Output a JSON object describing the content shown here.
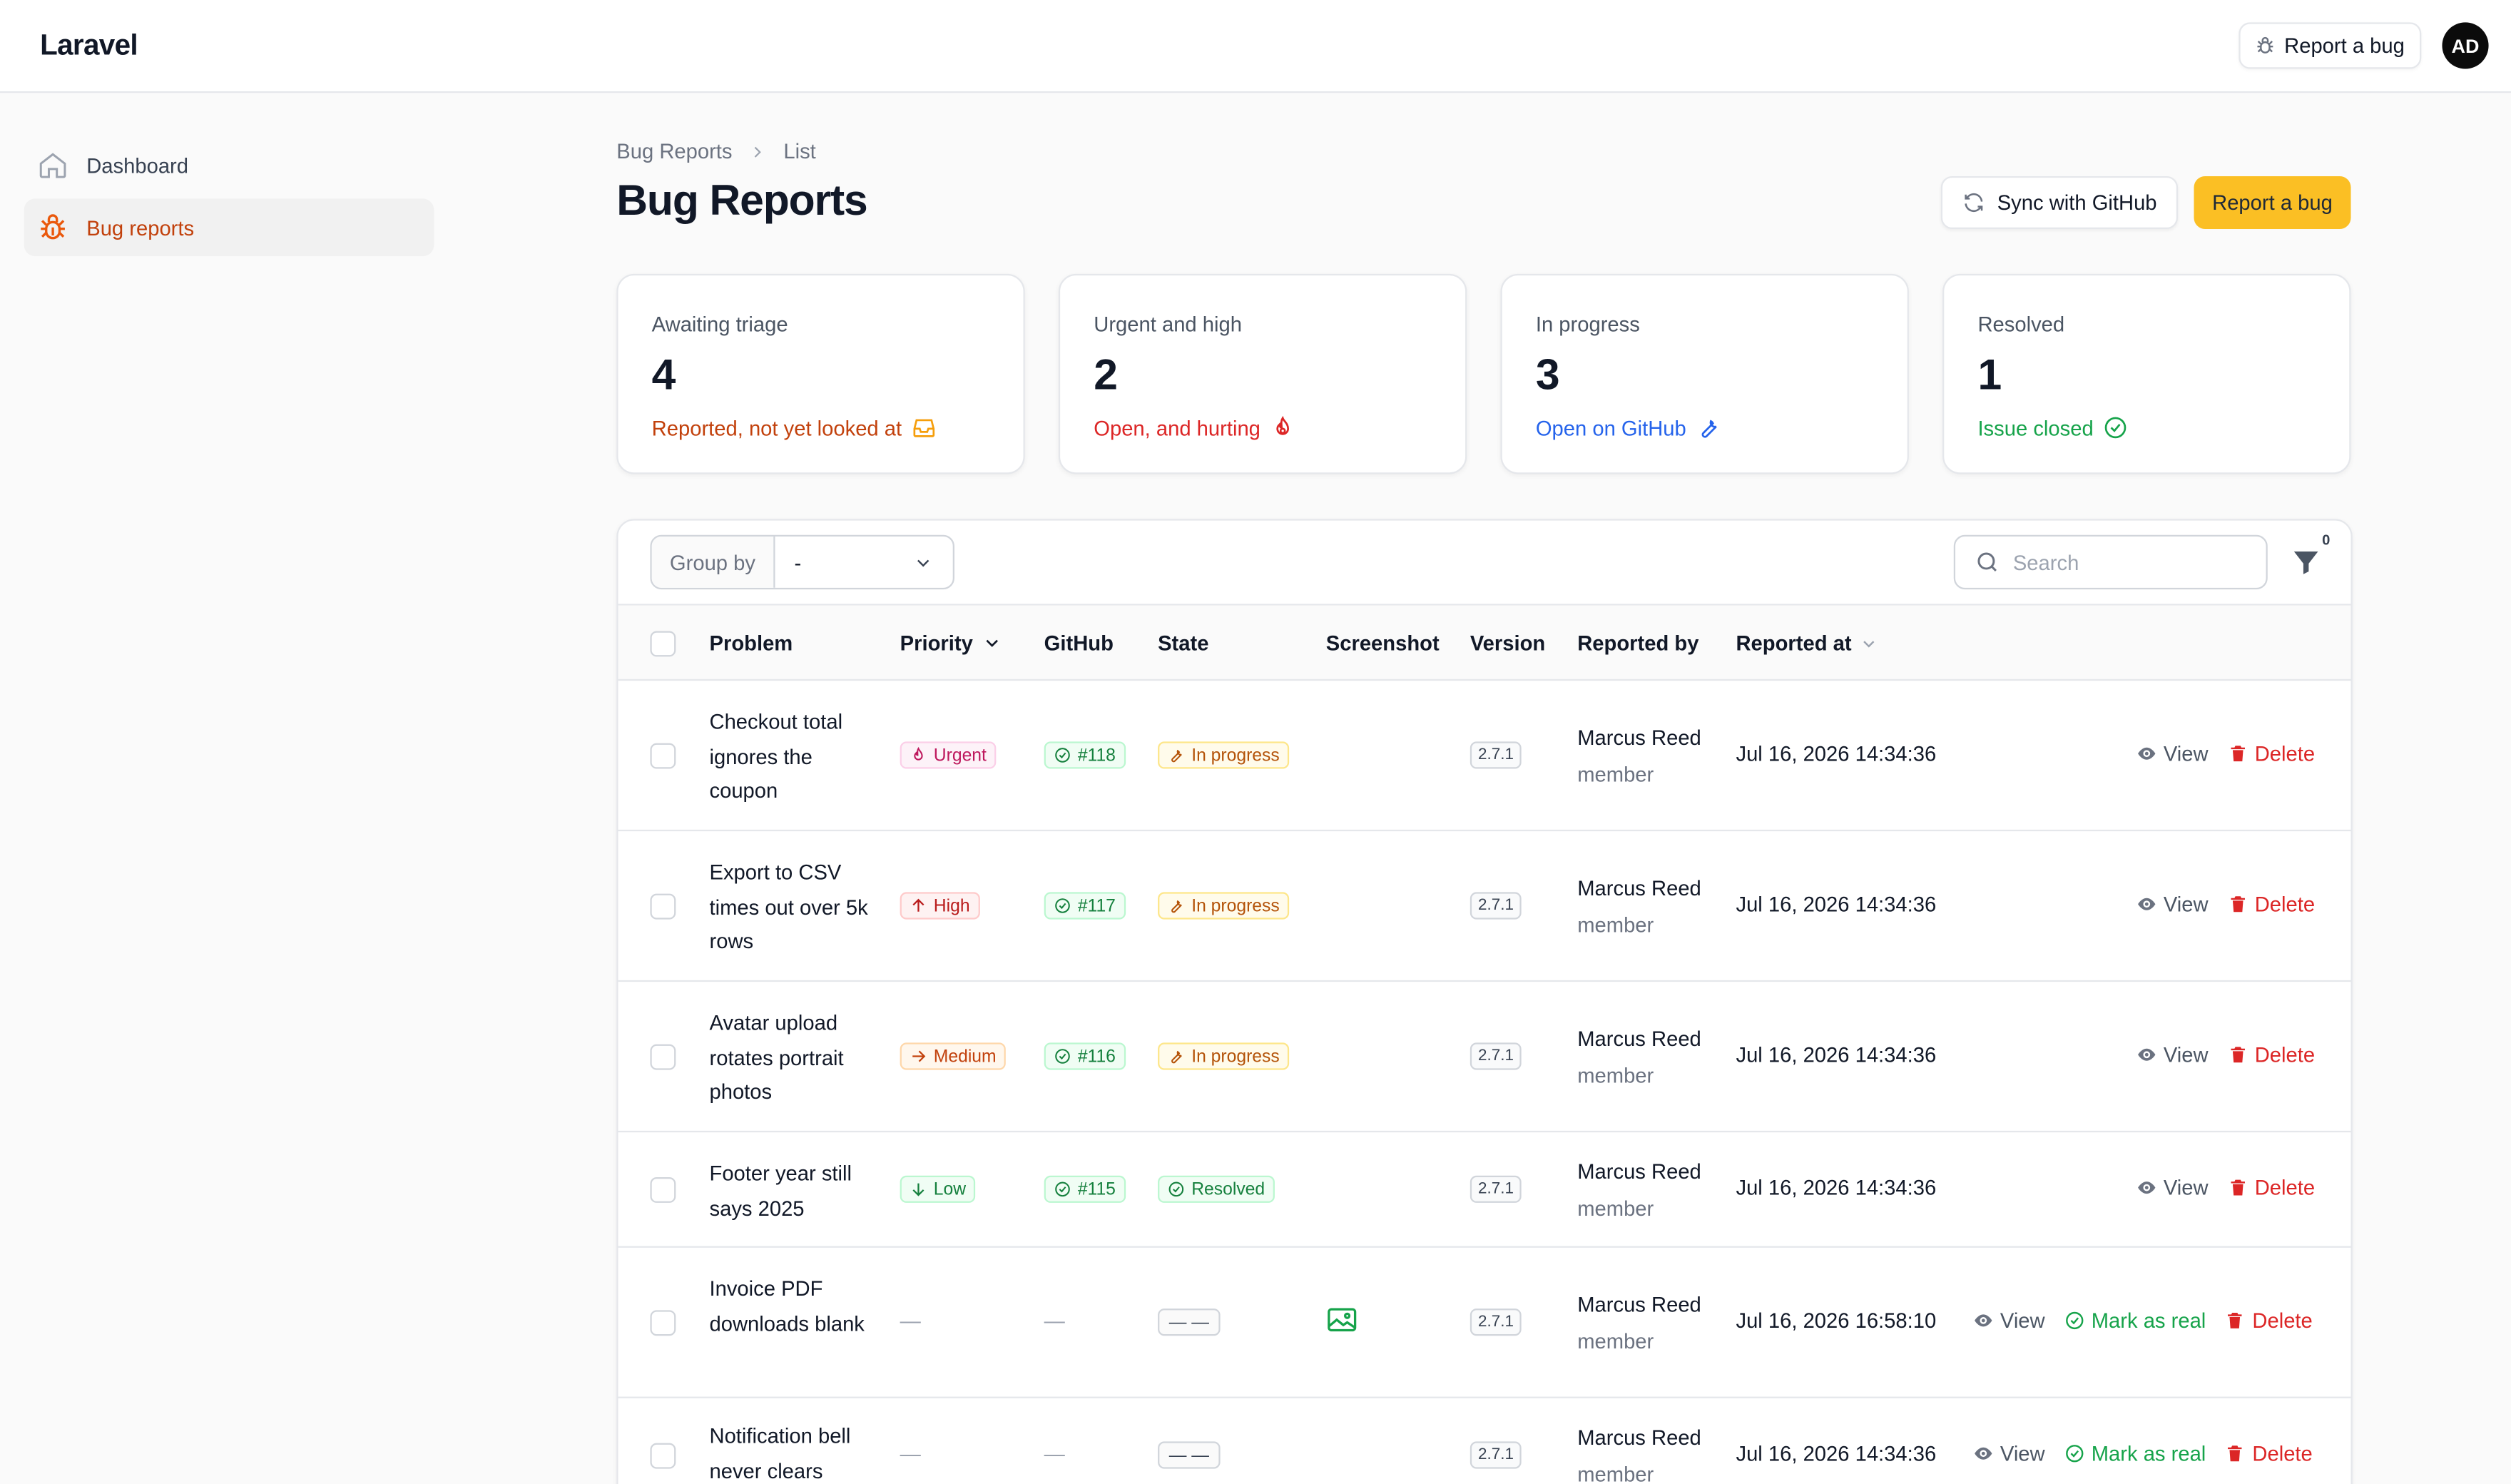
{
  "app": {
    "brand": "Laravel"
  },
  "topbar": {
    "report_label": "Report a bug",
    "avatar_initials": "AD"
  },
  "sidebar": {
    "items": [
      {
        "label": "Dashboard",
        "icon": "home-icon"
      },
      {
        "label": "Bug reports",
        "icon": "bug-icon",
        "active": true
      }
    ]
  },
  "breadcrumb": {
    "parent": "Bug Reports",
    "current": "List"
  },
  "page": {
    "title": "Bug Reports",
    "sync_label": "Sync with GitHub",
    "report_label": "Report a bug"
  },
  "stats": [
    {
      "label": "Awaiting triage",
      "value": "4",
      "desc": "Reported, not yet looked at",
      "icon": "inbox-icon",
      "color": "#c2410c"
    },
    {
      "label": "Urgent and high",
      "value": "2",
      "desc": "Open, and hurting",
      "icon": "fire-icon",
      "color": "#dc2626"
    },
    {
      "label": "In progress",
      "value": "3",
      "desc": "Open on GitHub",
      "icon": "wrench-icon",
      "color": "#2563eb"
    },
    {
      "label": "Resolved",
      "value": "1",
      "desc": "Issue closed",
      "icon": "check-circle-icon",
      "color": "#16a34a"
    }
  ],
  "toolbar": {
    "group_by_label": "Group by",
    "group_by_value": "-",
    "search_placeholder": "Search",
    "filter_count": "0"
  },
  "columns": {
    "problem": "Problem",
    "priority": "Priority",
    "github": "GitHub",
    "state": "State",
    "screenshot": "Screenshot",
    "version": "Version",
    "reported_by": "Reported by",
    "reported_at": "Reported at"
  },
  "actions": {
    "view": "View",
    "delete": "Delete",
    "mark_real": "Mark as real"
  },
  "rows": [
    {
      "problem": "Checkout total ignores the coupon",
      "priority": "Urgent",
      "github": "#118",
      "state": "In progress",
      "version": "2.7.1",
      "reporter": "Marcus Reed",
      "role": "member",
      "reported_at": "Jul 16, 2026 14:34:36"
    },
    {
      "problem": "Export to CSV times out over 5k rows",
      "priority": "High",
      "github": "#117",
      "state": "In progress",
      "version": "2.7.1",
      "reporter": "Marcus Reed",
      "role": "member",
      "reported_at": "Jul 16, 2026 14:34:36"
    },
    {
      "problem": "Avatar upload rotates portrait photos",
      "priority": "Medium",
      "github": "#116",
      "state": "In progress",
      "version": "2.7.1",
      "reporter": "Marcus Reed",
      "role": "member",
      "reported_at": "Jul 16, 2026 14:34:36"
    },
    {
      "problem": "Footer year still says 2025",
      "priority": "Low",
      "github": "#115",
      "state": "Resolved",
      "version": "2.7.1",
      "reporter": "Marcus Reed",
      "role": "member",
      "reported_at": "Jul 16, 2026 14:34:36"
    },
    {
      "problem": "Invoice PDF downloads blank",
      "priority": "—",
      "github": "—",
      "state": "— —",
      "version": "2.7.1",
      "reporter": "Marcus Reed",
      "role": "member",
      "reported_at": "Jul 16, 2026 16:58:10"
    },
    {
      "problem": "Notification bell never clears",
      "priority": "—",
      "github": "—",
      "state": "— —",
      "version": "2.7.1",
      "reporter": "Marcus Reed",
      "role": "member",
      "reported_at": "Jul 16, 2026 14:34:36"
    }
  ]
}
